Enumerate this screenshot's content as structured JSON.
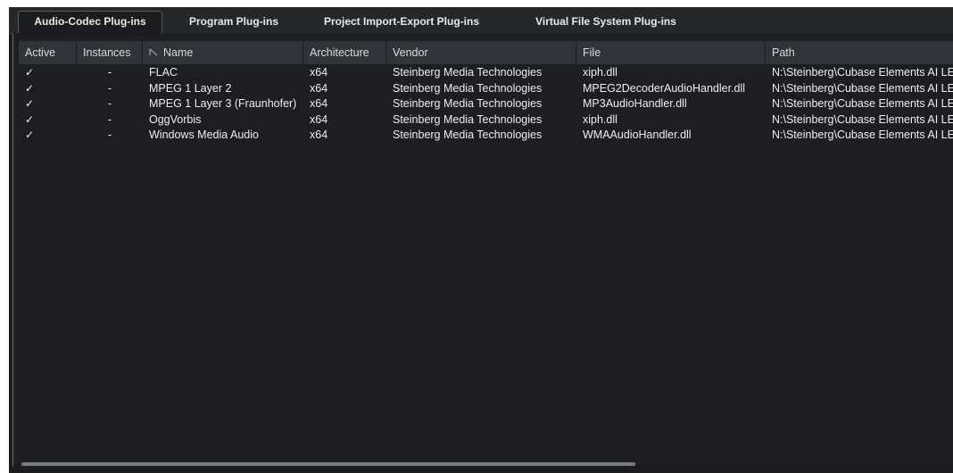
{
  "tabs": [
    {
      "label": "Audio-Codec Plug-ins",
      "active": true
    },
    {
      "label": "Program Plug-ins",
      "active": false
    },
    {
      "label": "Project Import-Export Plug-ins",
      "active": false
    },
    {
      "label": "Virtual File System Plug-ins",
      "active": false
    }
  ],
  "table": {
    "columns": [
      "Active",
      "Instances",
      "Name",
      "Architecture",
      "Vendor",
      "File",
      "Path"
    ],
    "rows": [
      {
        "active": "✓",
        "instances": "-",
        "name": "FLAC",
        "architecture": "x64",
        "vendor": "Steinberg Media Technologies",
        "file": "xiph.dll",
        "path": "N:\\Steinberg\\Cubase Elements AI LE"
      },
      {
        "active": "✓",
        "instances": "-",
        "name": "MPEG 1 Layer 2",
        "architecture": "x64",
        "vendor": "Steinberg Media Technologies",
        "file": "MPEG2DecoderAudioHandler.dll",
        "path": "N:\\Steinberg\\Cubase Elements AI LE"
      },
      {
        "active": "✓",
        "instances": "-",
        "name": "MPEG 1 Layer 3 (Fraunhofer)",
        "architecture": "x64",
        "vendor": "Steinberg Media Technologies",
        "file": "MP3AudioHandler.dll",
        "path": "N:\\Steinberg\\Cubase Elements AI LE"
      },
      {
        "active": "✓",
        "instances": "-",
        "name": "OggVorbis",
        "architecture": "x64",
        "vendor": "Steinberg Media Technologies",
        "file": "xiph.dll",
        "path": "N:\\Steinberg\\Cubase Elements AI LE"
      },
      {
        "active": "✓",
        "instances": "-",
        "name": "Windows Media Audio",
        "architecture": "x64",
        "vendor": "Steinberg Media Technologies",
        "file": "WMAAudioHandler.dll",
        "path": "N:\\Steinberg\\Cubase Elements AI LE"
      }
    ]
  },
  "icons": {
    "sort": "sort-ascending-icon",
    "check": "check-icon"
  }
}
